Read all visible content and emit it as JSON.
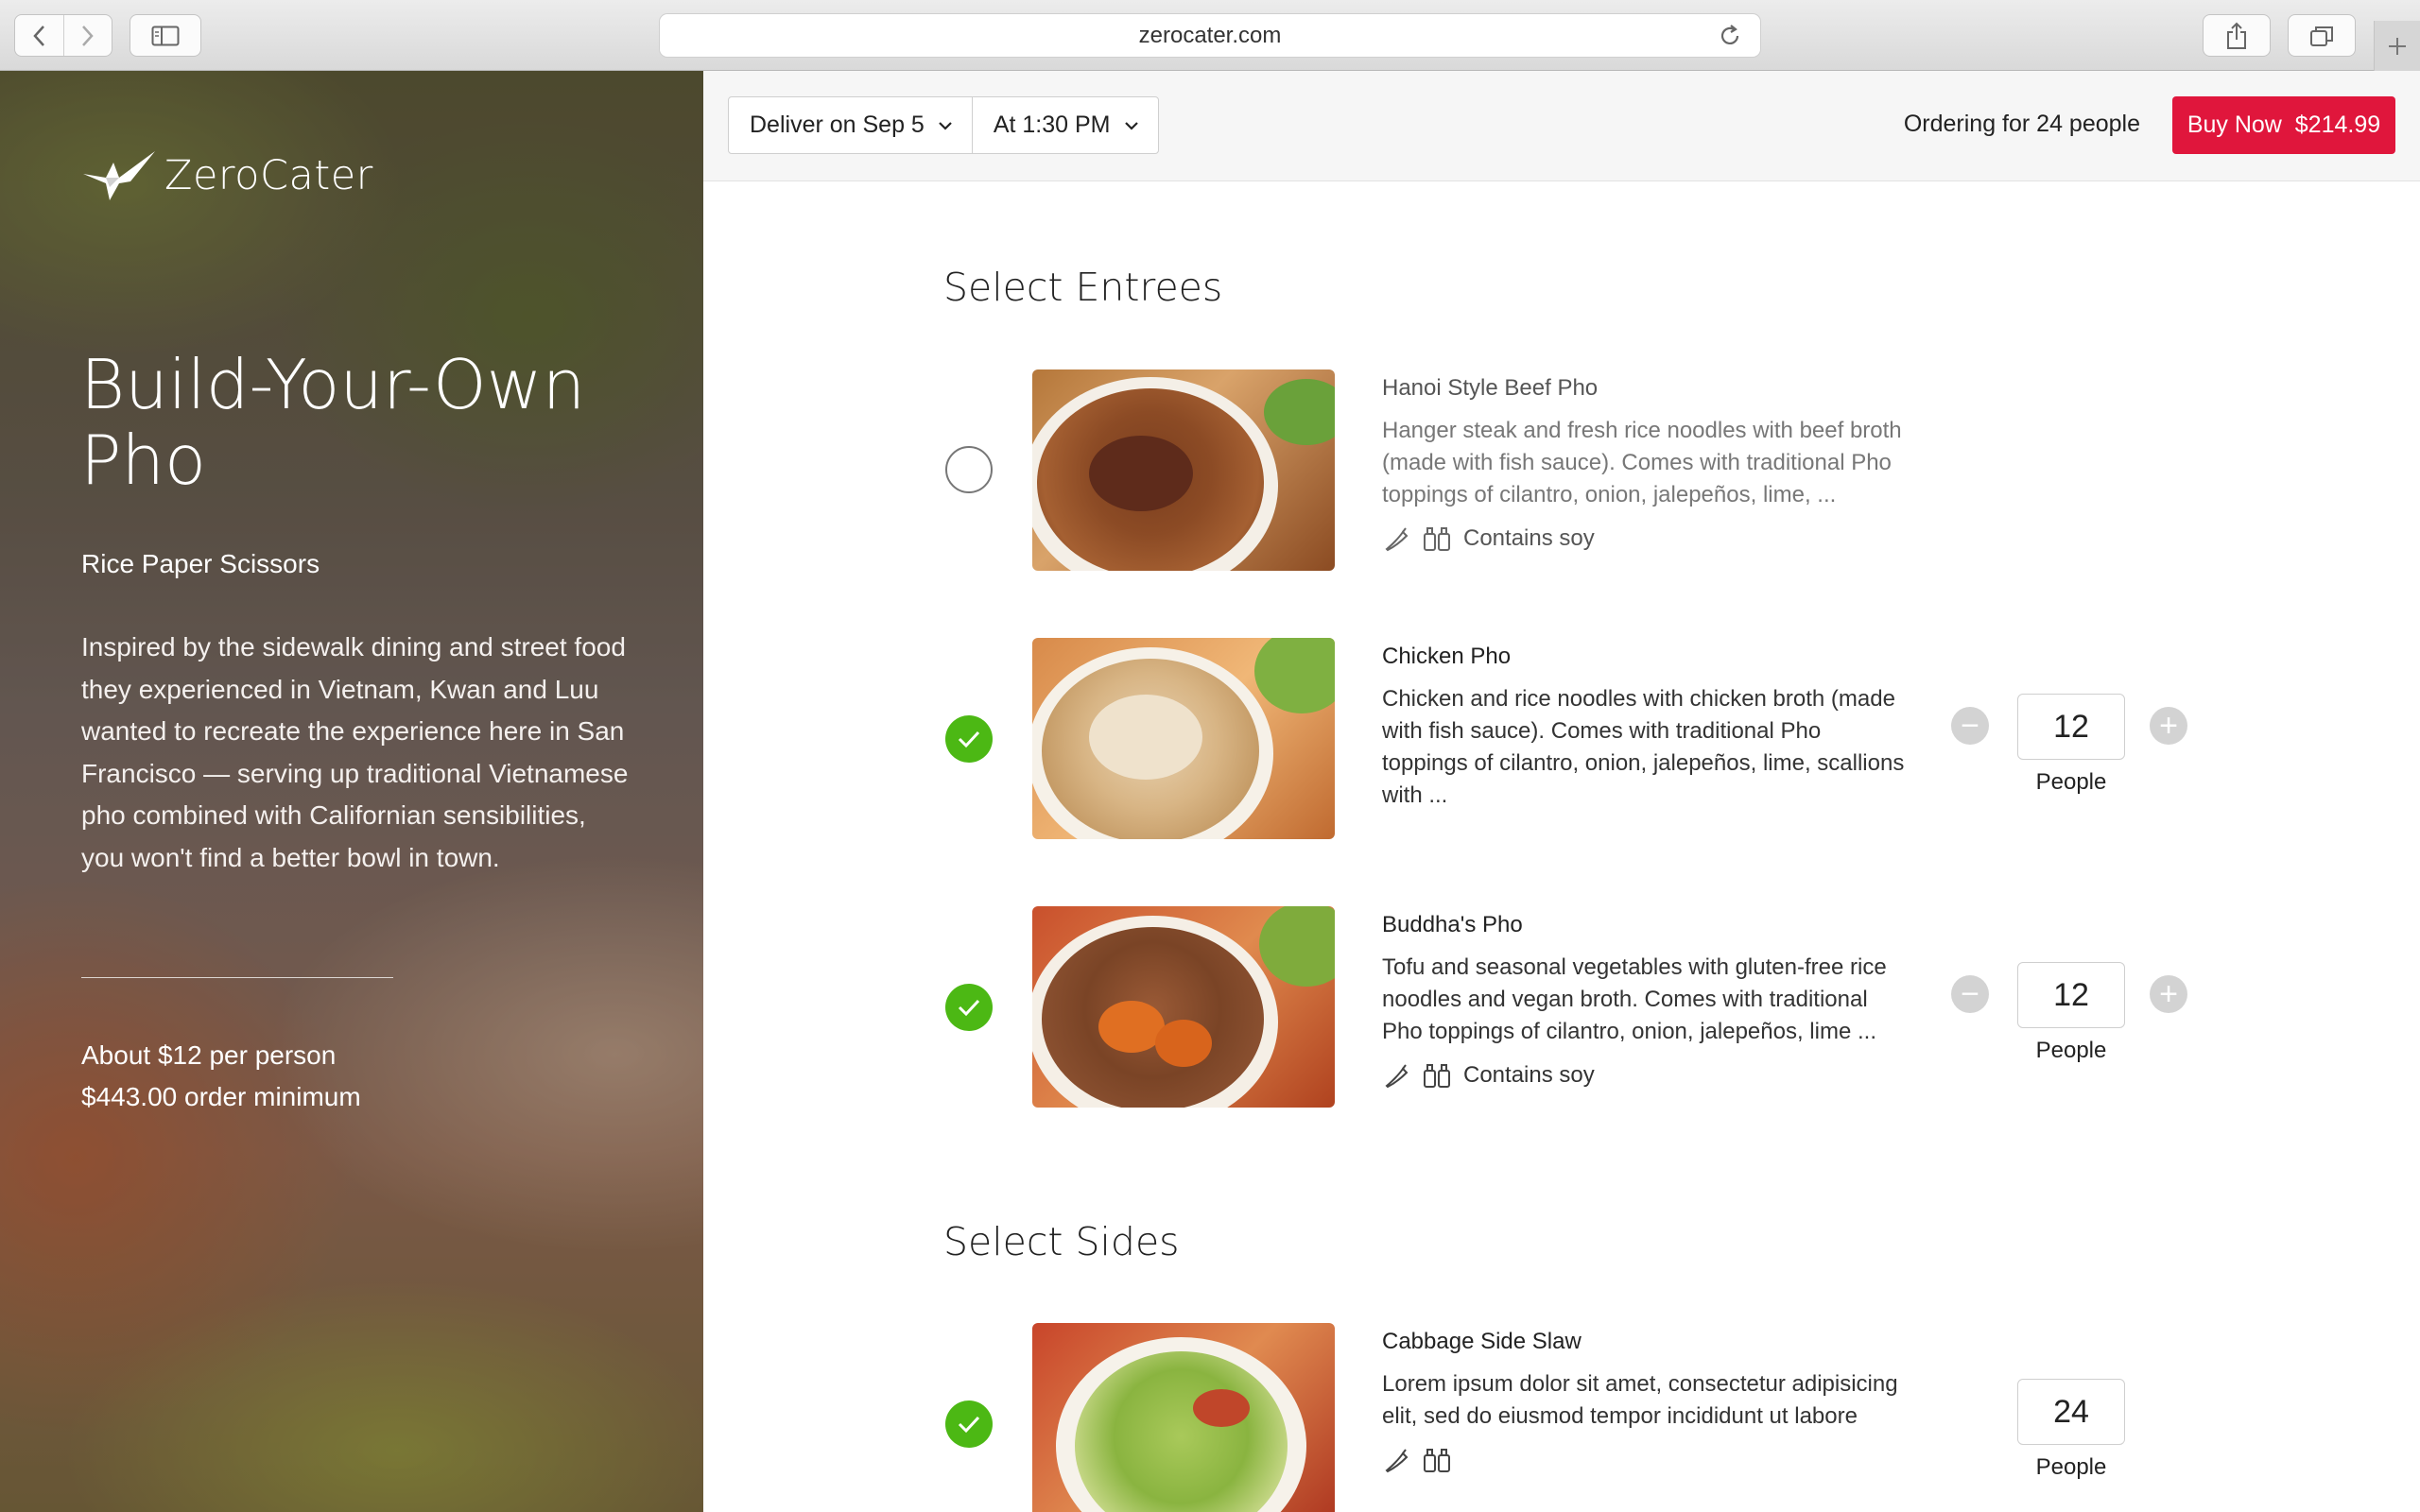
{
  "browser": {
    "url": "zerocater.com"
  },
  "hero": {
    "brand": "ZeroCater",
    "title": "Build-Your-Own Pho",
    "restaurant": "Rice Paper Scissors",
    "description": "Inspired by the sidewalk dining and street food they experienced in Vietnam, Kwan and Luu wanted to recreate the experience here in San Francisco — serving up traditional Vietnamese pho combined with Californian sensibilities, you won't find a better bowl in town.",
    "price_per_person": "About $12 per person",
    "order_minimum": "$443.00 order minimum"
  },
  "orderbar": {
    "deliver_date": "Deliver on Sep 5",
    "deliver_time": "At 1:30 PM",
    "ordering_for": "Ordering for 24 people",
    "buy_label": "Buy Now",
    "buy_price": "$214.99"
  },
  "sections": {
    "entrees_title": "Select Entrees",
    "sides_title": "Select Sides"
  },
  "entrees": [
    {
      "name": "Hanoi Style Beef Pho",
      "description": "Hanger steak and fresh rice noodles with beef broth (made with fish sauce). Comes with traditional Pho toppings of cilantro, onion, jalepeños, lime, ...",
      "diet_note": "Contains soy",
      "selected": false
    },
    {
      "name": "Chicken Pho",
      "description": "Chicken and rice noodles with chicken broth (made with fish sauce). Comes with traditional Pho toppings of cilantro, onion, jalepeños, lime, scallions with ...",
      "selected": true,
      "quantity": "12",
      "quantity_label": "People"
    },
    {
      "name": "Buddha's Pho",
      "description": "Tofu and seasonal vegetables with gluten-free rice noodles and vegan broth. Comes with traditional Pho toppings of cilantro, onion, jalepeños, lime ...",
      "diet_note": "Contains soy",
      "selected": true,
      "quantity": "12",
      "quantity_label": "People"
    }
  ],
  "sides": [
    {
      "name": "Cabbage Side Slaw",
      "description": "Lorem ipsum dolor sit amet, consectetur adipisicing elit, sed do eiusmod tempor incididunt ut labore",
      "selected": true,
      "quantity": "24",
      "quantity_label": "People"
    }
  ],
  "colors": {
    "accent_red": "#e0163c",
    "check_green": "#4cb814"
  }
}
